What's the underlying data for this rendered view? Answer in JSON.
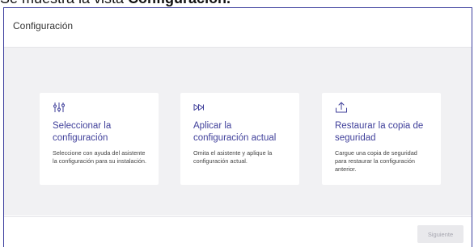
{
  "doc_heading": {
    "prefix": "Se muestra la vista ",
    "bold": "Configuración."
  },
  "window": {
    "title": "Configuración"
  },
  "cards": [
    {
      "icon": "sliders-icon",
      "title_line1": "Seleccionar la",
      "title_line2": "configuración",
      "description": "Seleccione con ayuda del asistente la configuración para su instalación."
    },
    {
      "icon": "skip-forward-icon",
      "title_line1": "Aplicar la",
      "title_line2": "configuración actual",
      "description": "Omita el asistente y aplique la configuración actual."
    },
    {
      "icon": "upload-icon",
      "title_line1": "Restaurar la copia de",
      "title_line2": "seguridad",
      "description": "Cargue una copia de seguridad para restaurar la configuración anterior."
    }
  ],
  "footer": {
    "next_label": "Siguiente"
  },
  "colors": {
    "accent": "#3f3f9a",
    "frame": "#3c3f9e",
    "content_bg": "#f1f1f3"
  }
}
